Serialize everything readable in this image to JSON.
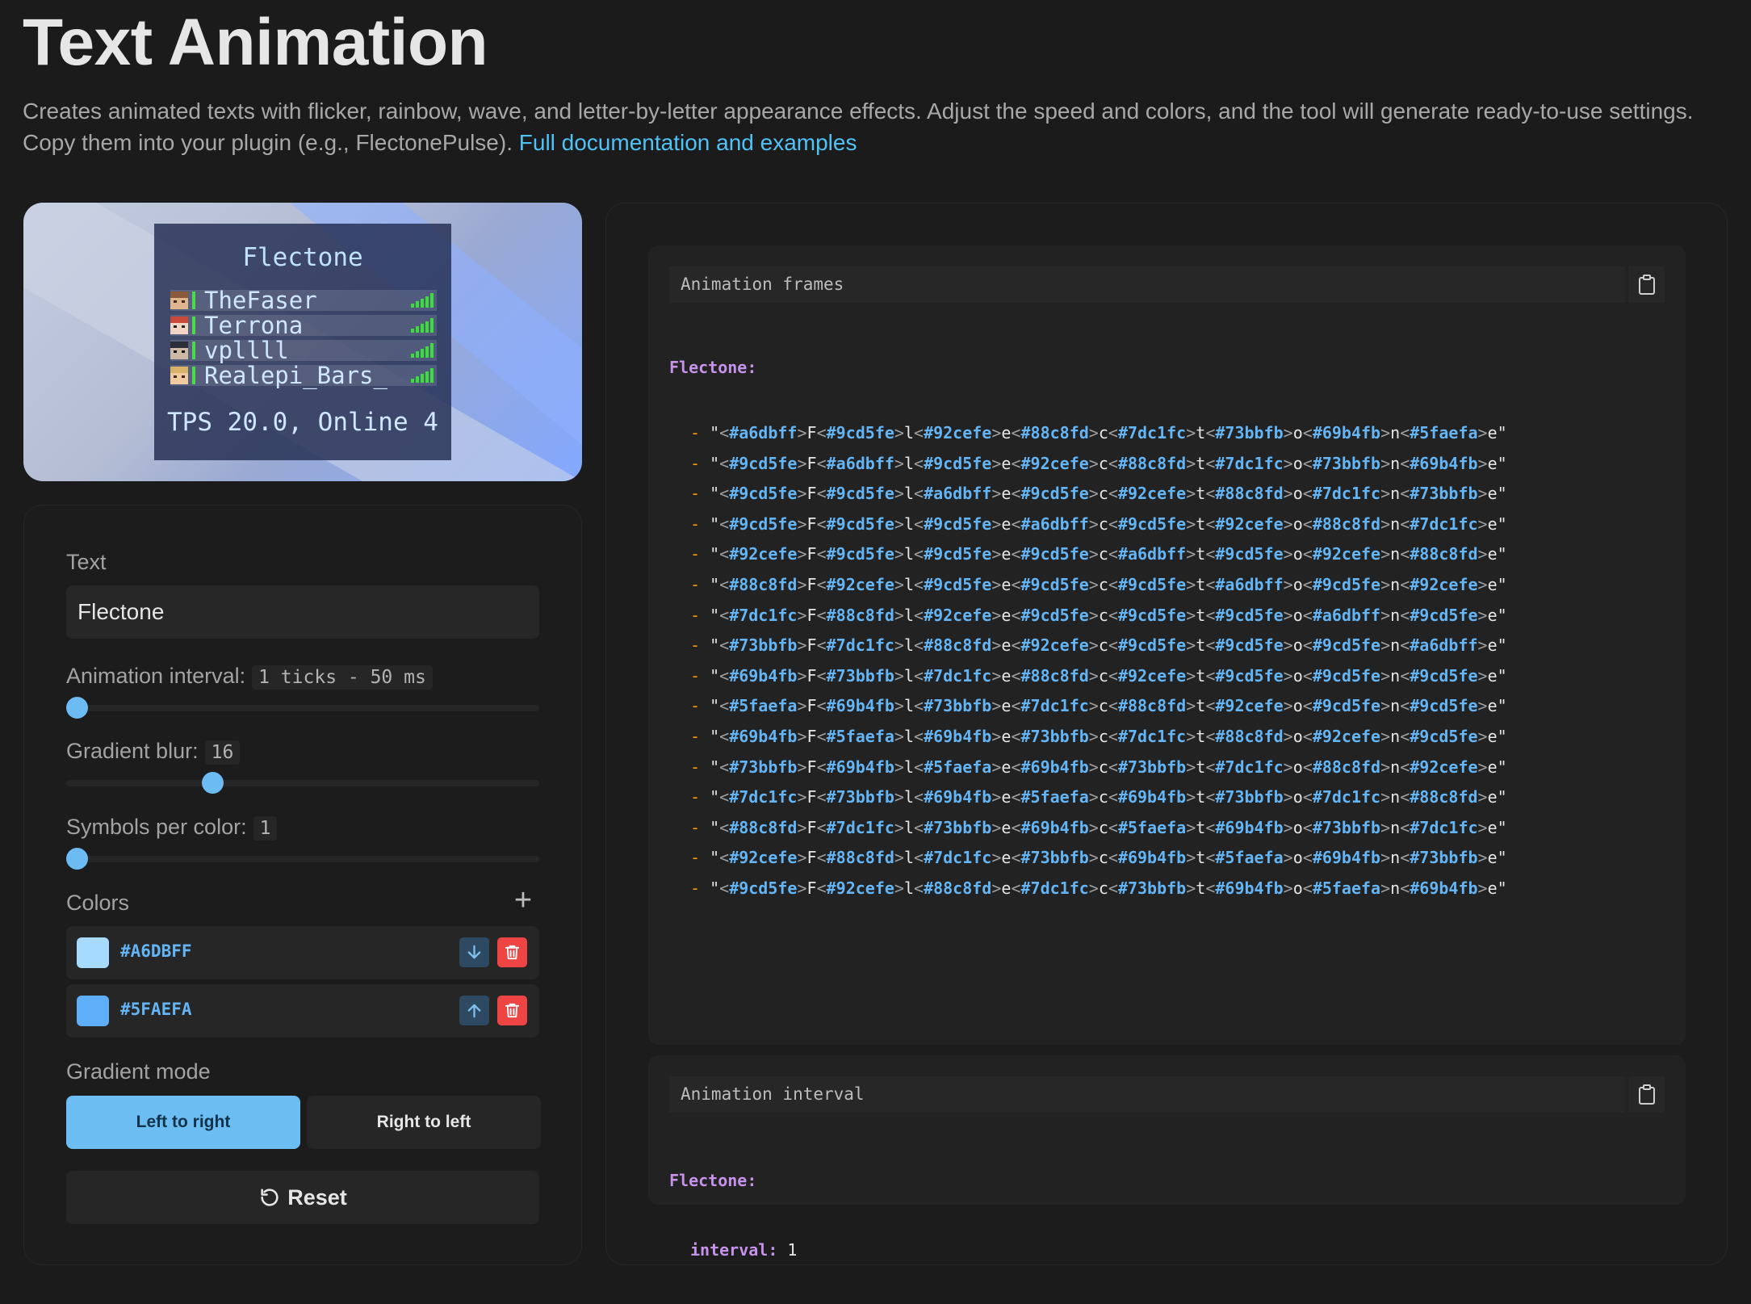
{
  "page": {
    "title": "Text Animation",
    "description": "Creates animated texts with flicker, rainbow, wave, and letter-by-letter appearance effects. Adjust the speed and colors, and the tool will generate ready-to-use settings. Copy them into your plugin (e.g., FlectonePulse).",
    "doc_link": "Full documentation and examples"
  },
  "preview": {
    "header": "Flectone",
    "players": [
      {
        "name": "TheFaser"
      },
      {
        "name": "Terrona"
      },
      {
        "name": "vpllll"
      },
      {
        "name": "Realepi_Bars_"
      }
    ],
    "footer": "TPS 20.0, Online 4"
  },
  "settings": {
    "text_label": "Text",
    "text_value": "Flectone",
    "interval_label": "Animation interval:",
    "interval_badge": "1 ticks - 50 ms",
    "interval_fraction": 0.0,
    "blur_label": "Gradient blur:",
    "blur_badge": "16",
    "blur_fraction": 0.3,
    "symbols_label": "Symbols per color:",
    "symbols_badge": "1",
    "symbols_fraction": 0.0,
    "colors_label": "Colors",
    "colors": [
      {
        "hex": "#A6DBFF",
        "swatch": "#a6dbff",
        "move_icon": "arrow-down-icon"
      },
      {
        "hex": "#5FAEFA",
        "swatch": "#5faefa",
        "move_icon": "arrow-up-icon"
      }
    ],
    "gradient_mode_label": "Gradient mode",
    "mode_left": "Left to right",
    "mode_right": "Right to left",
    "reset_label": "Reset"
  },
  "output": {
    "frames_title": "Animation frames",
    "frames_key": "Flectone:",
    "text_chars": [
      "F",
      "l",
      "e",
      "c",
      "t",
      "o",
      "n",
      "e"
    ],
    "frames": [
      [
        "#a6dbff",
        "#9cd5fe",
        "#92cefe",
        "#88c8fd",
        "#7dc1fc",
        "#73bbfb",
        "#69b4fb",
        "#5faefa"
      ],
      [
        "#9cd5fe",
        "#a6dbff",
        "#9cd5fe",
        "#92cefe",
        "#88c8fd",
        "#7dc1fc",
        "#73bbfb",
        "#69b4fb"
      ],
      [
        "#9cd5fe",
        "#9cd5fe",
        "#a6dbff",
        "#9cd5fe",
        "#92cefe",
        "#88c8fd",
        "#7dc1fc",
        "#73bbfb"
      ],
      [
        "#9cd5fe",
        "#9cd5fe",
        "#9cd5fe",
        "#a6dbff",
        "#9cd5fe",
        "#92cefe",
        "#88c8fd",
        "#7dc1fc"
      ],
      [
        "#92cefe",
        "#9cd5fe",
        "#9cd5fe",
        "#9cd5fe",
        "#a6dbff",
        "#9cd5fe",
        "#92cefe",
        "#88c8fd"
      ],
      [
        "#88c8fd",
        "#92cefe",
        "#9cd5fe",
        "#9cd5fe",
        "#9cd5fe",
        "#a6dbff",
        "#9cd5fe",
        "#92cefe"
      ],
      [
        "#7dc1fc",
        "#88c8fd",
        "#92cefe",
        "#9cd5fe",
        "#9cd5fe",
        "#9cd5fe",
        "#a6dbff",
        "#9cd5fe"
      ],
      [
        "#73bbfb",
        "#7dc1fc",
        "#88c8fd",
        "#92cefe",
        "#9cd5fe",
        "#9cd5fe",
        "#9cd5fe",
        "#a6dbff"
      ],
      [
        "#69b4fb",
        "#73bbfb",
        "#7dc1fc",
        "#88c8fd",
        "#92cefe",
        "#9cd5fe",
        "#9cd5fe",
        "#9cd5fe"
      ],
      [
        "#5faefa",
        "#69b4fb",
        "#73bbfb",
        "#7dc1fc",
        "#88c8fd",
        "#92cefe",
        "#9cd5fe",
        "#9cd5fe"
      ],
      [
        "#69b4fb",
        "#5faefa",
        "#69b4fb",
        "#73bbfb",
        "#7dc1fc",
        "#88c8fd",
        "#92cefe",
        "#9cd5fe"
      ],
      [
        "#73bbfb",
        "#69b4fb",
        "#5faefa",
        "#69b4fb",
        "#73bbfb",
        "#7dc1fc",
        "#88c8fd",
        "#92cefe"
      ],
      [
        "#7dc1fc",
        "#73bbfb",
        "#69b4fb",
        "#5faefa",
        "#69b4fb",
        "#73bbfb",
        "#7dc1fc",
        "#88c8fd"
      ],
      [
        "#88c8fd",
        "#7dc1fc",
        "#73bbfb",
        "#69b4fb",
        "#5faefa",
        "#69b4fb",
        "#73bbfb",
        "#7dc1fc"
      ],
      [
        "#92cefe",
        "#88c8fd",
        "#7dc1fc",
        "#73bbfb",
        "#69b4fb",
        "#5faefa",
        "#69b4fb",
        "#73bbfb"
      ],
      [
        "#9cd5fe",
        "#92cefe",
        "#88c8fd",
        "#7dc1fc",
        "#73bbfb",
        "#69b4fb",
        "#5faefa",
        "#69b4fb"
      ]
    ],
    "interval_title": "Animation interval",
    "interval_key": "Flectone:",
    "interval_subkey": "interval:",
    "interval_value": "1"
  },
  "colors": {
    "accent": "#6cbef2",
    "danger": "#ef4444",
    "link": "#4fc3f7",
    "yaml_key": "#c792ea",
    "yaml_dash": "#ff9800"
  }
}
